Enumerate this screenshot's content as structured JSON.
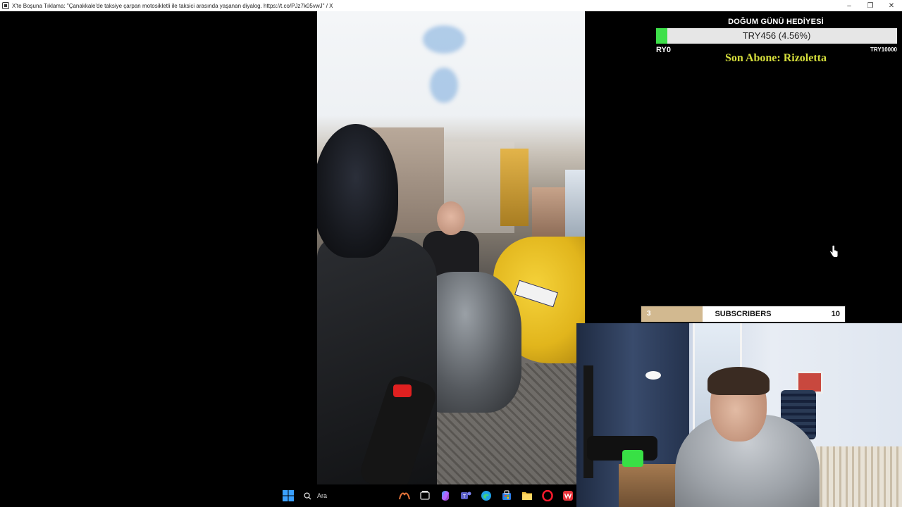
{
  "window": {
    "title": "X'te Boşuna Tıklama: \"Çanakkale'de taksiye çarpan motosikletli ile taksici arasında yaşanan diyalog. https://t.co/PJz7k05vwJ\" / X",
    "controls": {
      "minimize": "–",
      "maximize": "❐",
      "close": "✕"
    }
  },
  "donation_goal": {
    "title": "DOĞUM GÜNÜ HEDİYESİ",
    "progress_text": "TRY456 (4.56%)",
    "progress_fraction": 0.0456,
    "min_label": "RY0",
    "max_label": "TRY10000",
    "fill_color": "#3ee04a"
  },
  "last_subscriber": {
    "text": "Son Abone: Rizoletta",
    "color": "#d6df3c"
  },
  "subscribers_goal": {
    "current": "3",
    "label": "SUBSCRIBERS",
    "goal": "10",
    "progress_fraction": 0.3,
    "fill_color": "#d2b990"
  },
  "taskbar": {
    "search_label": "Ara",
    "icons": [
      "windows-start-icon",
      "search-icon",
      "task-view-icon",
      "copilot-icon",
      "teams-icon",
      "edge-icon",
      "store-icon",
      "file-explorer-icon",
      "opera-icon",
      "wps-office-icon"
    ]
  }
}
